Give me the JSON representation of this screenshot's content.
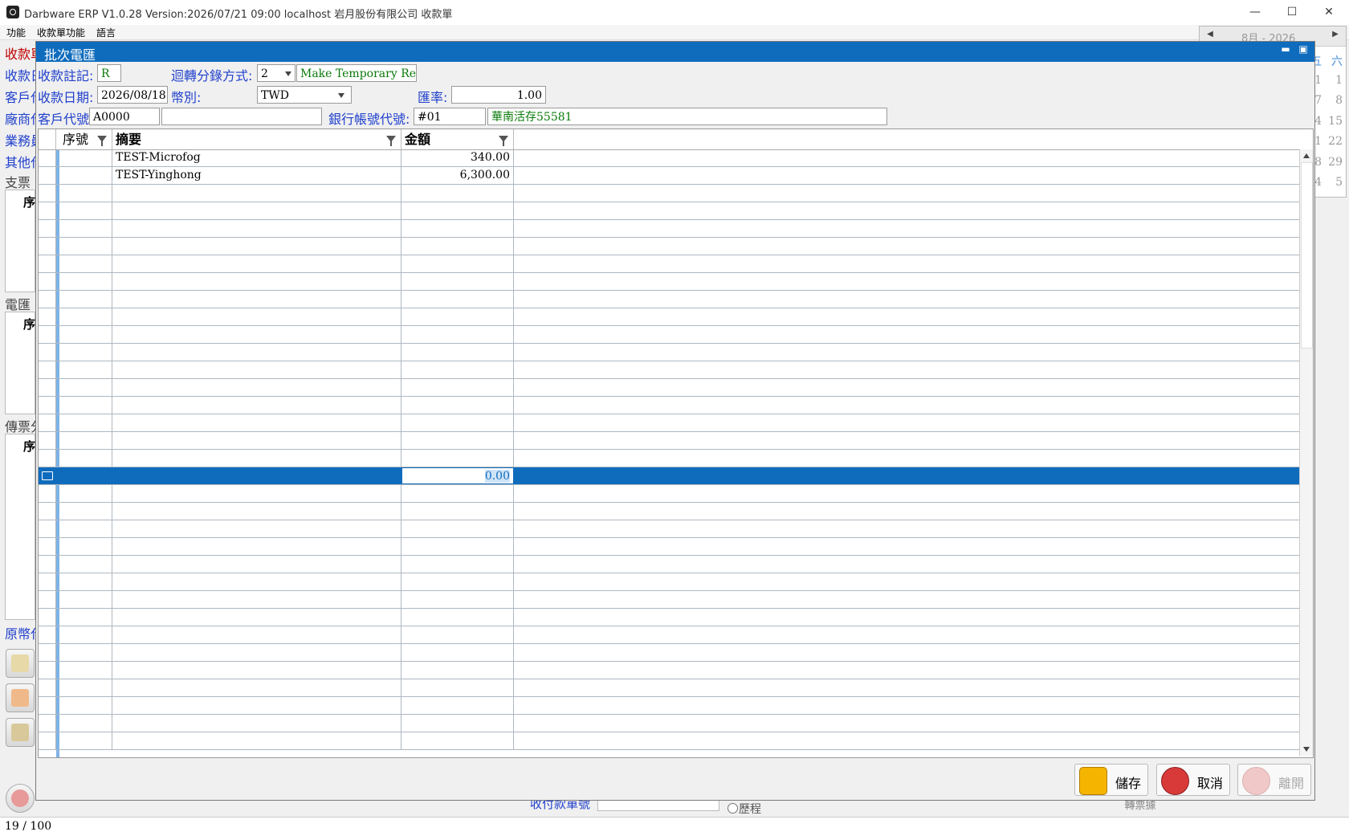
{
  "window": {
    "title": "Darbware ERP V1.0.28 Version:2026/07/21 09:00   localhost 岩月股份有限公司 收款單",
    "minimize": "—",
    "maximize": "☐",
    "close": "✕"
  },
  "menu": [
    "功能",
    "收款單功能",
    "語言"
  ],
  "calendar": {
    "header": "8月 - 2026",
    "prev": "◀",
    "next": "▶",
    "weekday_fri": "五",
    "weekday_sat": "六",
    "cells": [
      "1",
      "1",
      "7",
      "8",
      "4",
      "15",
      "1",
      "22",
      "8",
      "29",
      "4",
      "5"
    ]
  },
  "background": {
    "labels": [
      "收款單",
      "收款日",
      "客戶代",
      "廠商代",
      "業務員",
      "其他代",
      "支票",
      "電匯",
      "傳票分",
      "原幣代"
    ],
    "seq_headers": [
      "序",
      "序",
      "序"
    ],
    "bottom_label": "收付款單號",
    "radio_label": "歷程",
    "bottom_combo": "轉票據"
  },
  "dialog": {
    "title": "批次電匯",
    "fields": {
      "remark_label": "收款註記:",
      "remark_value": "R",
      "posting_label": "迴轉分錄方式:",
      "posting_value": "2",
      "posting_desc": "Make Temporary Rec",
      "date_label": "收款日期:",
      "date_value": "2026/08/18",
      "currency_label": "幣別:",
      "currency_value": "TWD",
      "rate_label": "匯率:",
      "rate_value": "1.00",
      "customer_label": "客戶代號",
      "customer_value": "A0000",
      "customer_name": "",
      "bank_label": "銀行帳號代號:",
      "bank_value": "#01",
      "bank_name": "華南活存55581"
    },
    "grid": {
      "columns": [
        "序號",
        "摘要",
        "金額"
      ],
      "rows": [
        {
          "seq": "",
          "summary": "TEST-Microfog",
          "amount": "340.00"
        },
        {
          "seq": "",
          "summary": "TEST-Yinghong",
          "amount": "6,300.00"
        }
      ],
      "new_row_amount": "0.00"
    },
    "buttons": {
      "save": "儲存",
      "cancel": "取消",
      "exit": "離開"
    }
  },
  "status": {
    "record": "19  /  100"
  }
}
